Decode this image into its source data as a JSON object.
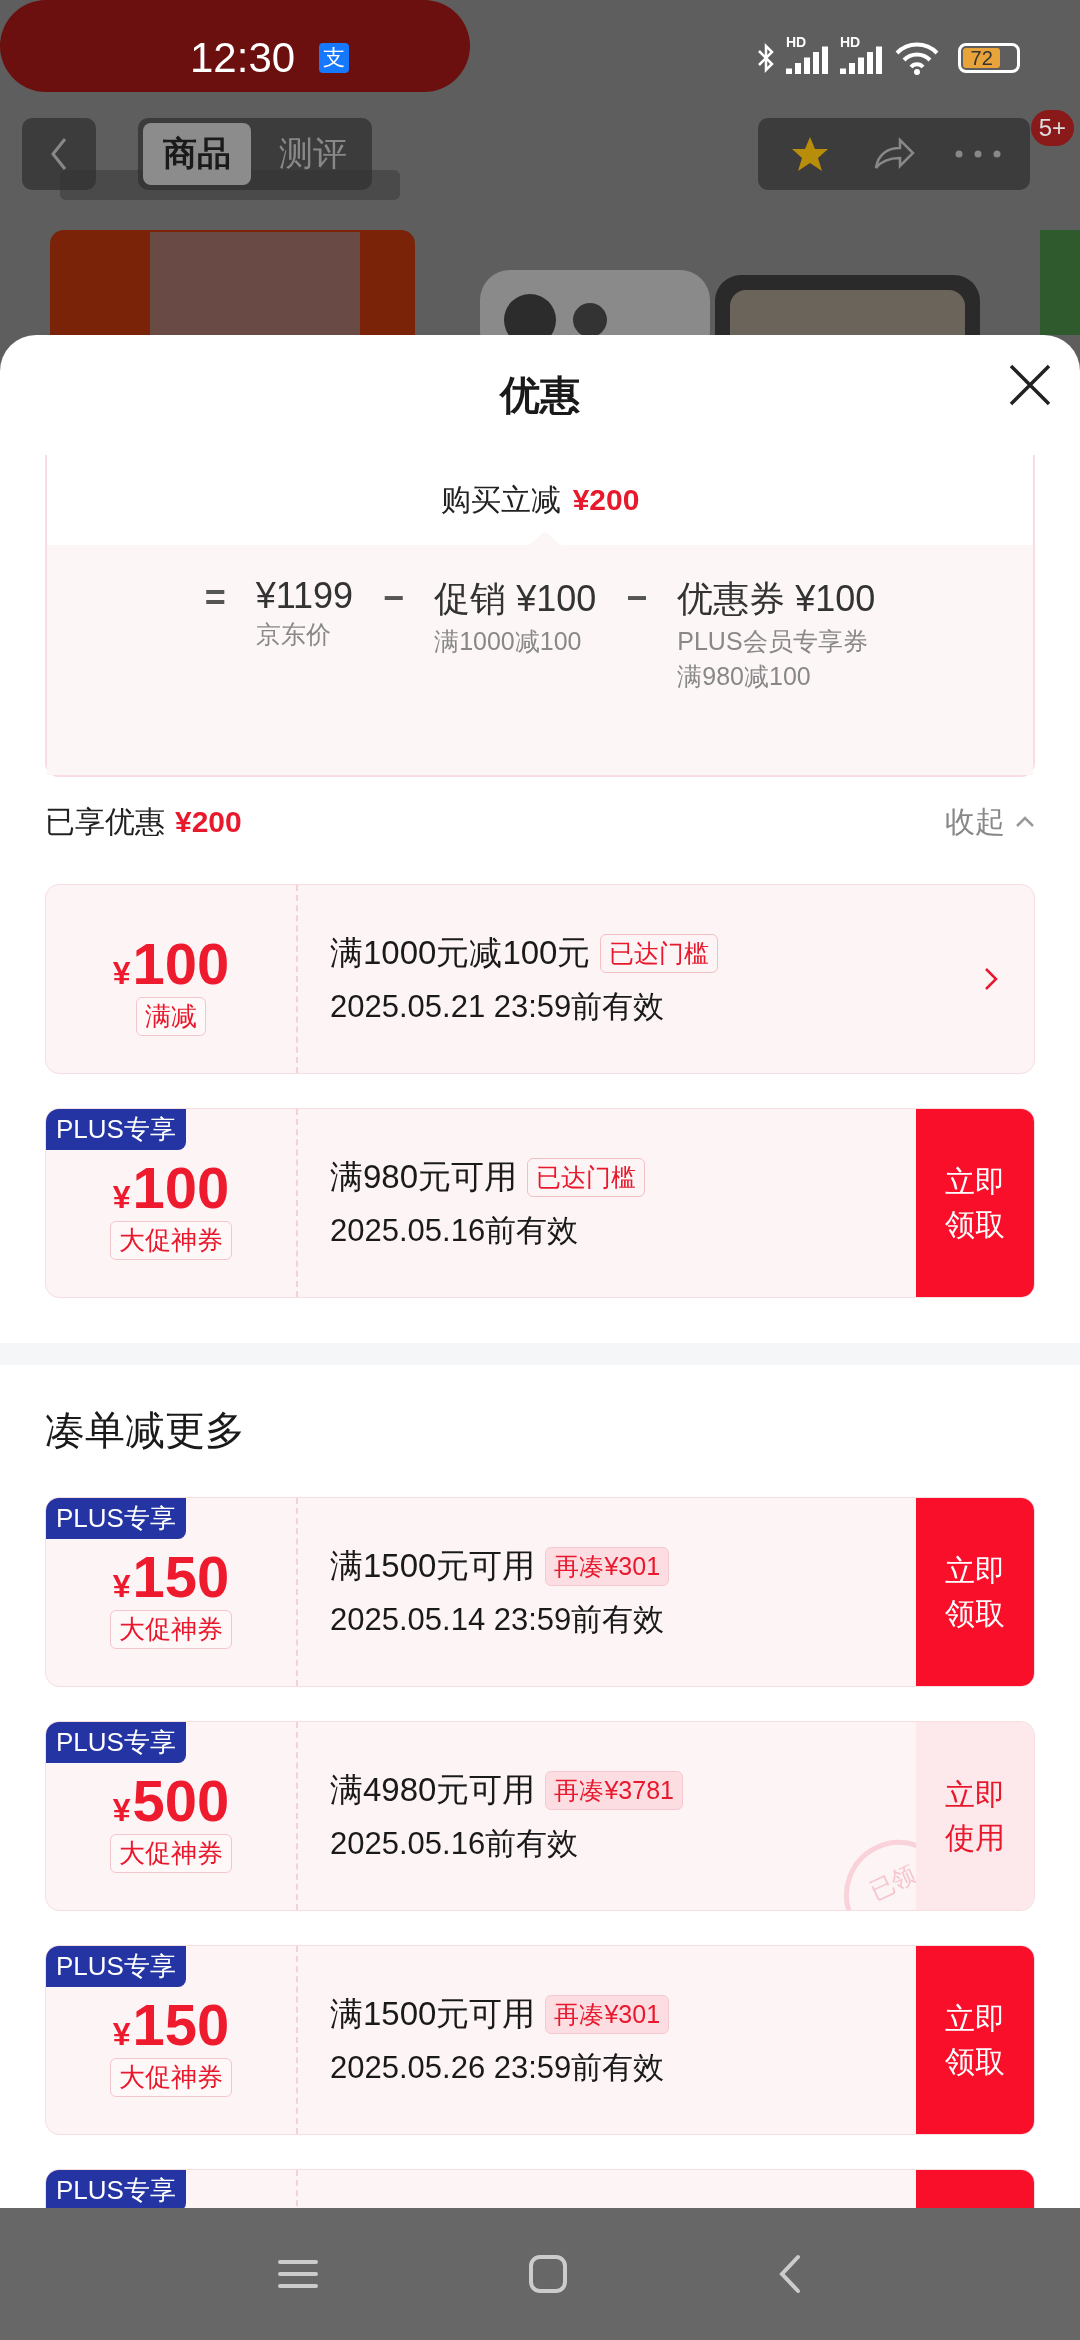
{
  "status_bar": {
    "time": "12:30",
    "app_icon": "支",
    "network": [
      "HD",
      "HD"
    ],
    "battery": "72"
  },
  "nav": {
    "tabs": [
      {
        "label": "商品",
        "selected": true
      },
      {
        "label": "测评",
        "selected": false
      }
    ],
    "badge": "5+"
  },
  "sheet": {
    "title": "优惠",
    "summary": {
      "label": "购买立减",
      "amount": "¥200",
      "formula": [
        {
          "kind": "op",
          "text": "="
        },
        {
          "kind": "term",
          "value": "¥1199",
          "notes": [
            "京东价"
          ]
        },
        {
          "kind": "op",
          "text": "−"
        },
        {
          "kind": "term",
          "value": "促销 ¥100",
          "notes": [
            "满1000减100"
          ]
        },
        {
          "kind": "op",
          "text": "−"
        },
        {
          "kind": "term",
          "value": "优惠券 ¥100",
          "notes": [
            "PLUS会员专享券",
            "满980减100"
          ]
        }
      ]
    },
    "enjoyed": {
      "label": "已享优惠",
      "amount": "¥200",
      "toggle": "收起",
      "expanded": true
    },
    "coupons": [
      {
        "currency": "¥",
        "amount": "100",
        "type": "满减",
        "title": "满1000元减100元",
        "badge": {
          "kind": "reached",
          "text": "已达门槛"
        },
        "date": "2025.05.21 23:59前有效",
        "action": {
          "kind": "arrow"
        }
      },
      {
        "tag": "PLUS专享",
        "currency": "¥",
        "amount": "100",
        "type": "大促神券",
        "title": "满980元可用",
        "badge": {
          "kind": "reached",
          "text": "已达门槛"
        },
        "date": "2025.05.16前有效",
        "action": {
          "kind": "claim",
          "text": "立即领取"
        }
      }
    ],
    "more_title": "凑单减更多",
    "more_coupons": [
      {
        "tag": "PLUS专享",
        "currency": "¥",
        "amount": "150",
        "type": "大促神券",
        "title": "满1500元可用",
        "badge": {
          "kind": "more",
          "text": "再凑¥301"
        },
        "date": "2025.05.14 23:59前有效",
        "action": {
          "kind": "claim",
          "text": "立即领取"
        }
      },
      {
        "tag": "PLUS专享",
        "currency": "¥",
        "amount": "500",
        "type": "大促神券",
        "title": "满4980元可用",
        "badge": {
          "kind": "more",
          "text": "再凑¥3781"
        },
        "date": "2025.05.16前有效",
        "action": {
          "kind": "use",
          "text": "立即使用"
        },
        "stamp": "已领"
      },
      {
        "tag": "PLUS专享",
        "currency": "¥",
        "amount": "150",
        "type": "大促神券",
        "title": "满1500元可用",
        "badge": {
          "kind": "more",
          "text": "再凑¥301"
        },
        "date": "2025.05.26 23:59前有效",
        "action": {
          "kind": "claim",
          "text": "立即领取"
        }
      },
      {
        "tag": "PLUS专享",
        "action": {
          "kind": "claim"
        }
      }
    ]
  }
}
